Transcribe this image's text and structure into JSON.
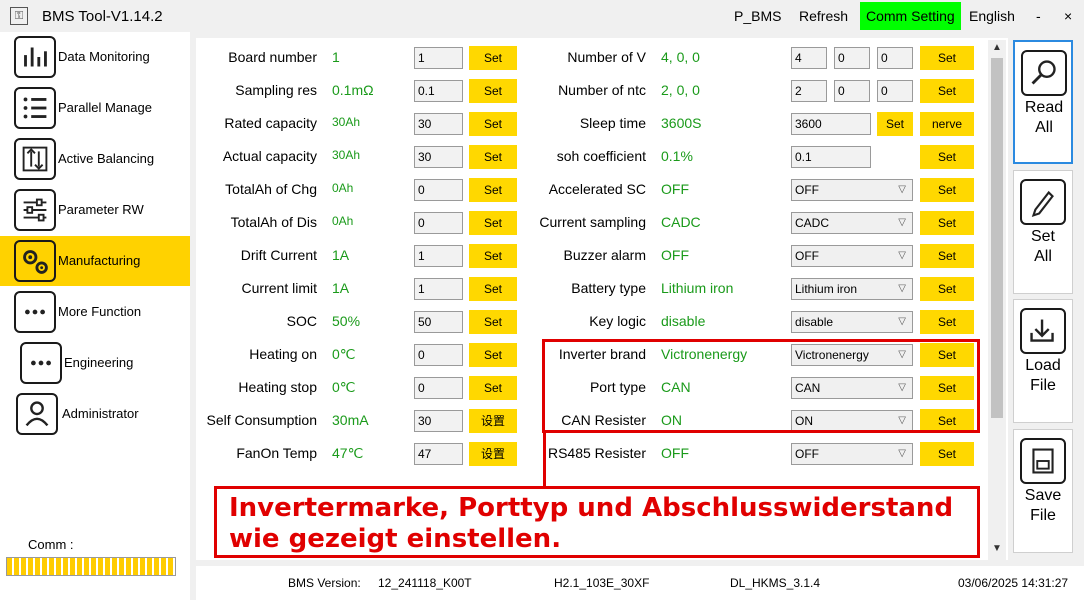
{
  "window": {
    "title": "BMS Tool-V1.14.2",
    "menu": {
      "pbms": "P_BMS",
      "refresh": "Refresh",
      "comm_setting": "Comm Setting",
      "language": "English",
      "minimize": "-",
      "close": "×"
    }
  },
  "sidebar": {
    "items": [
      {
        "label": "Data Monitoring",
        "icon": "bar-chart-icon"
      },
      {
        "label": "Parallel Manage",
        "icon": "list-icon"
      },
      {
        "label": "Active Balancing",
        "icon": "balance-icon"
      },
      {
        "label": "Parameter RW",
        "icon": "sliders-icon"
      },
      {
        "label": "Manufacturing",
        "icon": "gears-icon",
        "active": true
      },
      {
        "label": "More Function",
        "icon": "more-icon"
      },
      {
        "label": "Engineering",
        "icon": "more-icon"
      },
      {
        "label": "Administrator",
        "icon": "user-icon"
      }
    ],
    "comm_label": "Comm :",
    "comm_progress": 1.0
  },
  "left_params": [
    {
      "label": "Board number",
      "value": "1",
      "input": "1",
      "button": "Set"
    },
    {
      "label": "Sampling res",
      "value": "0.1mΩ",
      "input": "0.1",
      "button": "Set"
    },
    {
      "label": "Rated capacity",
      "value": "30Ah",
      "input": "30",
      "button": "Set"
    },
    {
      "label": "Actual capacity",
      "value": "30Ah",
      "input": "30",
      "button": "Set"
    },
    {
      "label": "TotalAh of Chg",
      "value": "0Ah",
      "input": "0",
      "button": "Set"
    },
    {
      "label": "TotalAh of Dis",
      "value": "0Ah",
      "input": "0",
      "button": "Set"
    },
    {
      "label": "Drift Current",
      "value": "1A",
      "input": "1",
      "button": "Set"
    },
    {
      "label": "Current limit",
      "value": "1A",
      "input": "1",
      "button": "Set"
    },
    {
      "label": "SOC",
      "value": "50%",
      "input": "50",
      "button": "Set"
    },
    {
      "label": "Heating on",
      "value": "0℃",
      "input": "0",
      "button": "Set"
    },
    {
      "label": "Heating stop",
      "value": "0℃",
      "input": "0",
      "button": "Set"
    },
    {
      "label": "Self Consumption",
      "value": "30mA",
      "input": "30",
      "button": "设置"
    },
    {
      "label": "FanOn Temp",
      "value": "47℃",
      "input": "47",
      "button": "设置"
    }
  ],
  "right_params": {
    "number_of_v": {
      "label": "Number of V",
      "value": "4, 0, 0",
      "inputs": [
        "4",
        "0",
        "0"
      ],
      "button": "Set"
    },
    "number_of_ntc": {
      "label": "Number of ntc",
      "value": "2, 0, 0",
      "inputs": [
        "2",
        "0",
        "0"
      ],
      "button": "Set"
    },
    "sleep_time": {
      "label": "Sleep time",
      "value": "3600S",
      "input": "3600",
      "button": "Set",
      "button2": "nerve"
    },
    "soh": {
      "label": "soh coefficient",
      "value": "0.1%",
      "input": "0.1",
      "button": "Set"
    },
    "dropdowns": [
      {
        "label": "Accelerated SC",
        "value": "OFF",
        "selected": "OFF",
        "button": "Set"
      },
      {
        "label": "Current sampling",
        "value": "CADC",
        "selected": "CADC",
        "button": "Set"
      },
      {
        "label": "Buzzer alarm",
        "value": "OFF",
        "selected": "OFF",
        "button": "Set"
      },
      {
        "label": "Battery type",
        "value": "Lithium iron",
        "selected": "Lithium iron",
        "button": "Set"
      },
      {
        "label": "Key logic",
        "value": "disable",
        "selected": "disable",
        "button": "Set"
      },
      {
        "label": "Inverter brand",
        "value": "Victronenergy",
        "selected": "Victronenergy",
        "button": "Set"
      },
      {
        "label": "Port type",
        "value": "CAN",
        "selected": "CAN",
        "button": "Set"
      },
      {
        "label": "CAN Resister",
        "value": "ON",
        "selected": "ON",
        "button": "Set"
      },
      {
        "label": "RS485 Resister",
        "value": "OFF",
        "selected": "OFF",
        "button": "Set"
      }
    ]
  },
  "actions": [
    {
      "line1": "Read",
      "line2": "All",
      "icon": "search-icon"
    },
    {
      "line1": "Set",
      "line2": "All",
      "icon": "pen-icon"
    },
    {
      "line1": "Load",
      "line2": "File",
      "icon": "download-icon"
    },
    {
      "line1": "Save",
      "line2": "File",
      "icon": "save-icon"
    }
  ],
  "status": {
    "bms_version_label": "BMS Version:",
    "bms_version": "12_241118_K00T",
    "hw": "H2.1_103E_30XF",
    "dl": "DL_HKMS_3.1.4",
    "datetime": "03/06/2025 14:31:27"
  },
  "annotation": {
    "text": "Invertermarke, Porttyp und Abschlusswiderstand wie gezeigt einstellen."
  },
  "colors": {
    "accent": "#ffd200",
    "value_green": "#1a9a1a",
    "highlight_red": "#e00000",
    "comm_green": "#00ff00"
  }
}
